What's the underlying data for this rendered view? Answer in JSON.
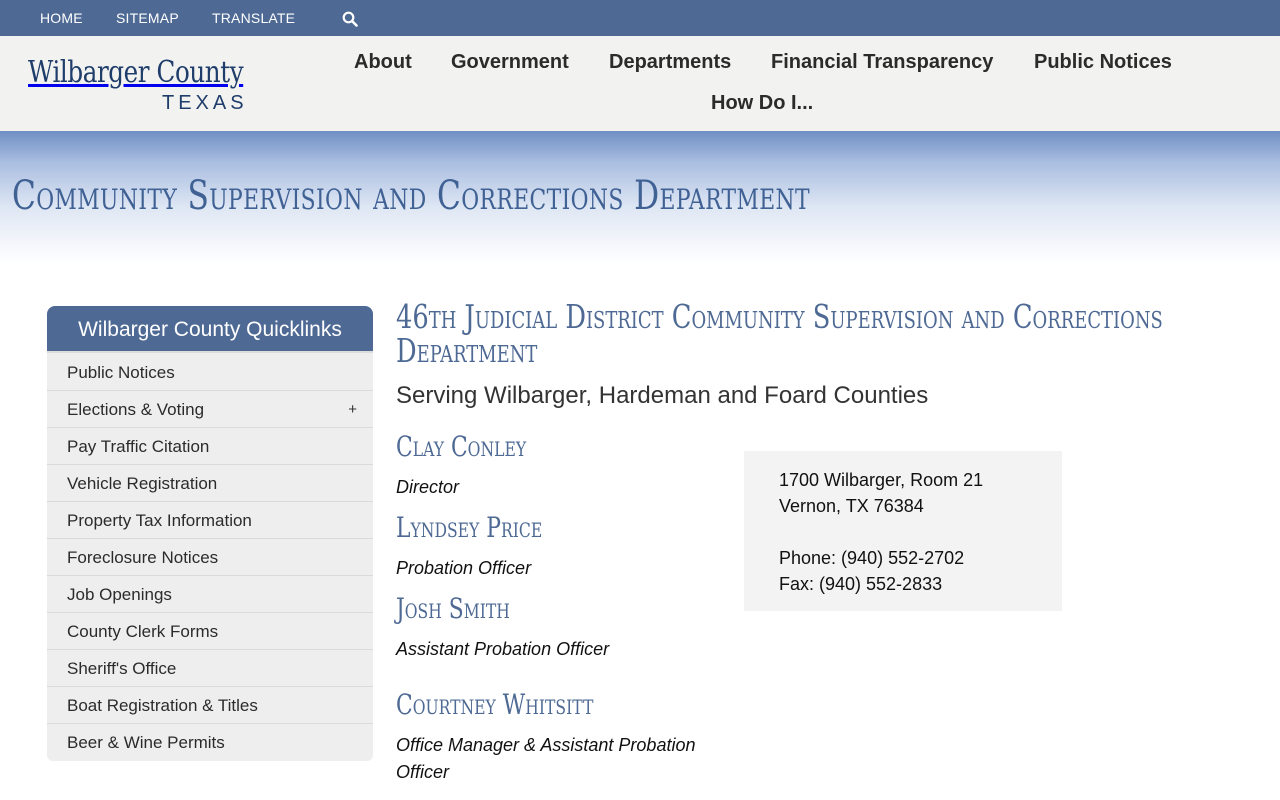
{
  "topbar": {
    "links": [
      "HOME",
      "SITEMAP",
      "TRANSLATE"
    ],
    "search_icon": "search-icon"
  },
  "logo": {
    "main": "Wilbarger County",
    "sub": "TEXAS"
  },
  "nav": {
    "items": [
      "About",
      "Government",
      "Departments",
      "Financial Transparency",
      "Public Notices",
      "How Do I..."
    ]
  },
  "banner": {
    "title": "Community Supervision and Corrections Department"
  },
  "sidebar": {
    "title": "Wilbarger County Quicklinks",
    "expand_symbol": "+",
    "items": [
      {
        "label": "Public Notices"
      },
      {
        "label": "Elections & Voting"
      },
      {
        "label": "Pay Traffic Citation"
      },
      {
        "label": "Vehicle Registration"
      },
      {
        "label": "Property Tax Information"
      },
      {
        "label": "Foreclosure Notices"
      },
      {
        "label": "Job Openings"
      },
      {
        "label": "County Clerk Forms"
      },
      {
        "label": "Sheriff's Office"
      },
      {
        "label": "Boat Registration & Titles"
      },
      {
        "label": "Beer & Wine Permits"
      }
    ]
  },
  "main": {
    "title": "46th Judicial District Community Supervision and Corrections Department",
    "subtitle": "Serving Wilbarger, Hardeman and Foard Counties",
    "staff": [
      {
        "name": "Clay Conley",
        "role": "Director"
      },
      {
        "name": "Lyndsey Price",
        "role": "Probation Officer"
      },
      {
        "name": "Josh Smith",
        "role": "Assistant Probation Officer"
      },
      {
        "name": "Courtney Whitsitt",
        "role": "Office Manager & Assistant Probation Officer"
      }
    ]
  },
  "contact": {
    "address1": "1700 Wilbarger, Room 21",
    "address2": "Vernon, TX 76384",
    "phone": "Phone: (940) 552-2702",
    "fax": "Fax: (940) 552-2833"
  },
  "colors": {
    "brand": "#4e6a94",
    "logo": "#1f3d6b",
    "header_bg": "#f2f2f0",
    "sidebar_bg": "#eeeeee",
    "contact_bg": "#f3f3f3"
  }
}
